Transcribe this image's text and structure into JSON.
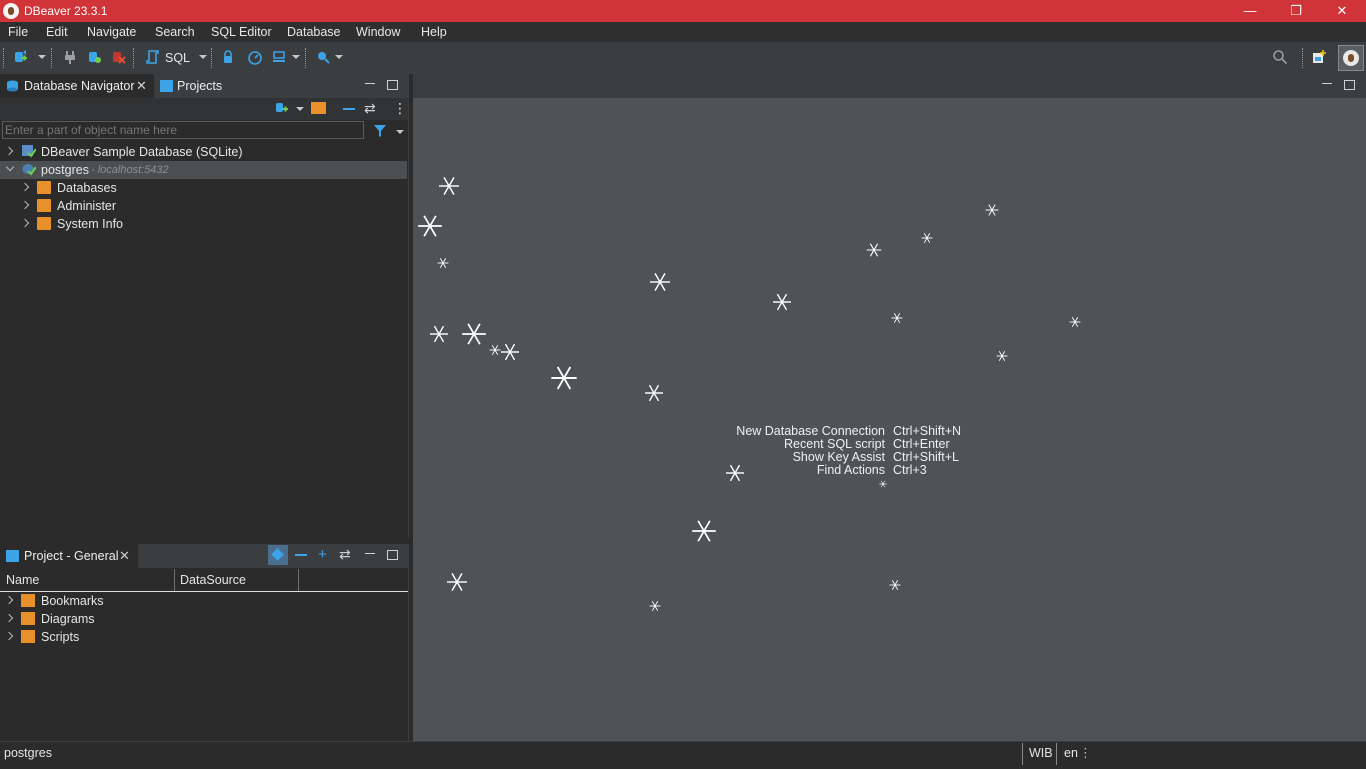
{
  "window": {
    "title": "DBeaver 23.3.1"
  },
  "menu": [
    "File",
    "Edit",
    "Navigate",
    "Search",
    "SQL Editor",
    "Database",
    "Window",
    "Help"
  ],
  "toolbar": {
    "sql_label": "SQL"
  },
  "navigator": {
    "tabs": [
      "Database Navigator",
      "Projects"
    ],
    "filter_placeholder": "Enter a part of object name here",
    "tree": [
      {
        "label": "DBeaver Sample Database (SQLite)",
        "expanded": false
      },
      {
        "label": "postgres",
        "host": " - localhost:5432",
        "expanded": true,
        "selected": true,
        "children": [
          "Databases",
          "Administer",
          "System Info"
        ]
      }
    ]
  },
  "project": {
    "tab": "Project - General",
    "columns": [
      "Name",
      "DataSource"
    ],
    "items": [
      "Bookmarks",
      "Diagrams",
      "Scripts"
    ]
  },
  "editor": {
    "shortcuts": [
      {
        "action": "New Database Connection",
        "keys": "Ctrl+Shift+N"
      },
      {
        "action": "Recent SQL script",
        "keys": "Ctrl+Enter"
      },
      {
        "action": "Show Key Assist",
        "keys": "Ctrl+Shift+L"
      },
      {
        "action": "Find Actions",
        "keys": "Ctrl+3"
      }
    ]
  },
  "statusbar": {
    "left": "postgres",
    "timezone": "WIB",
    "locale": "en"
  },
  "colors": {
    "titlebar": "#d13438",
    "accent": "#1e90ff",
    "folder": "#e8902a"
  }
}
